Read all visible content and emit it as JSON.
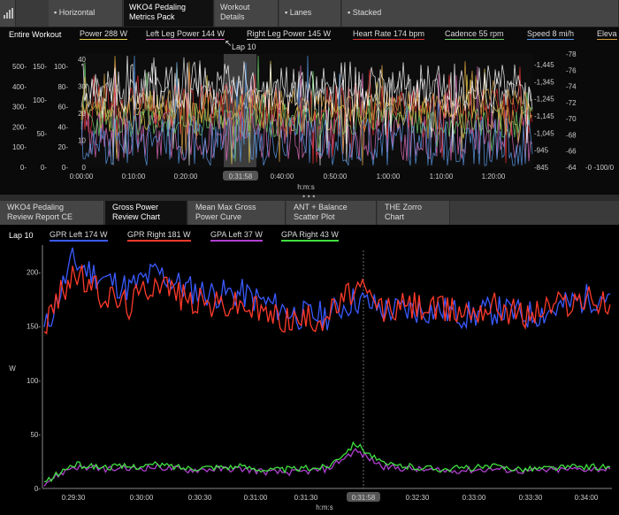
{
  "top_tabs": [
    {
      "label": "▪ Horizontal"
    },
    {
      "label": "WKO4 Pedaling\nMetrics Pack"
    },
    {
      "label": "Workout\nDetails"
    },
    {
      "label": "▪ Lanes"
    },
    {
      "label": "▪ Stacked"
    }
  ],
  "top_chart": {
    "range_label": "Entire Workout",
    "legend": [
      {
        "label": "Power  288 W",
        "color": "#e8d44d"
      },
      {
        "label": "Left Leg Power  144 W",
        "color": "#e070c0"
      },
      {
        "label": "Right Leg Power  145 W",
        "color": "#d8d8d8"
      },
      {
        "label": "Heart Rate  174 bpm",
        "color": "#e03030"
      },
      {
        "label": "Cadence  55 rpm",
        "color": "#70d070"
      },
      {
        "label": "Speed  8 mi/h",
        "color": "#5a9ae8"
      },
      {
        "label": "Eleva",
        "color": "#d4a040"
      }
    ],
    "lap_label": "Lap 10",
    "axis_power": [
      "500-",
      "400-",
      "300-",
      "200-",
      "100-",
      "0-"
    ],
    "axis_hr": [
      "150-",
      "100-",
      "50-",
      "0-"
    ],
    "axis_cad": [
      "100-",
      "80-",
      "60-",
      "40-",
      "20-",
      "0-"
    ],
    "axis_speed": [
      "40",
      "30",
      "20",
      "10",
      "0"
    ],
    "axis_elev": [
      "-1,445",
      "-1,345",
      "-1,245",
      "-1,145",
      "-1,045",
      "-945",
      "-845"
    ],
    "axis_right2": [
      "-78",
      "-76",
      "-74",
      "-72",
      "-70",
      "-68",
      "-66",
      "-64"
    ],
    "axis_right3": "-0  -100/0",
    "x_ticks": [
      "0:00:00",
      "0:10:00",
      "0:20:00",
      "0:31:58",
      "0:40:00",
      "0:50:00",
      "1:00:00",
      "1:10:00",
      "1:20:00"
    ],
    "x_label": "h:m:s"
  },
  "bottom_tabs": [
    {
      "label": "WKO4 Pedaling\nReview Report CE"
    },
    {
      "label": "Gross Power\nReview Chart"
    },
    {
      "label": "Mean Max Gross\nPower Curve"
    },
    {
      "label": "ANT + Balance\nScatter Plot"
    },
    {
      "label": "THE Zorro\nChart"
    }
  ],
  "bottom_chart": {
    "range_label": "Lap 10",
    "legend": [
      {
        "label": "GPR Left  174 W",
        "color": "#3a5aff"
      },
      {
        "label": "GPR Right  181 W",
        "color": "#ff3a2a"
      },
      {
        "label": "GPA Left  37 W",
        "color": "#b040d0"
      },
      {
        "label": "GPA Right  43 W",
        "color": "#40e040"
      }
    ],
    "y_ticks": [
      "200-",
      "150-",
      "100-",
      "50-",
      "0-"
    ],
    "y_label": "W",
    "x_ticks": [
      "0:29:30",
      "0:30:00",
      "0:30:30",
      "0:31:00",
      "0:31:30",
      "0:31:58",
      "0:32:30",
      "0:33:00",
      "0:33:30",
      "0:34:00"
    ],
    "x_label": "h:m:s"
  },
  "chart_data": {
    "type": "line",
    "title": "",
    "xlabel": "h:m:s",
    "ylabel": "W",
    "ylim": [
      0,
      225
    ],
    "x": [
      "0:29:15",
      "0:29:30",
      "0:29:45",
      "0:30:00",
      "0:30:15",
      "0:30:30",
      "0:30:45",
      "0:31:00",
      "0:31:15",
      "0:31:30",
      "0:31:45",
      "0:32:00",
      "0:32:15",
      "0:32:30",
      "0:32:45",
      "0:33:00",
      "0:33:15",
      "0:33:30",
      "0:33:45",
      "0:34:00",
      "0:34:10"
    ],
    "series": [
      {
        "name": "GPR Left",
        "color": "#3a5aff",
        "values": [
          145,
          210,
          195,
          185,
          200,
          185,
          180,
          180,
          170,
          160,
          160,
          175,
          165,
          165,
          165,
          160,
          165,
          160,
          165,
          175,
          180
        ]
      },
      {
        "name": "GPR Right",
        "color": "#ff3a2a",
        "values": [
          150,
          200,
          180,
          170,
          195,
          175,
          170,
          170,
          160,
          155,
          160,
          185,
          165,
          170,
          165,
          165,
          170,
          160,
          170,
          175,
          170
        ]
      },
      {
        "name": "GPA Left",
        "color": "#b040d0",
        "values": [
          5,
          20,
          18,
          18,
          20,
          17,
          18,
          18,
          15,
          15,
          18,
          35,
          20,
          18,
          16,
          17,
          18,
          16,
          17,
          18,
          18
        ]
      },
      {
        "name": "GPA Right",
        "color": "#40e040",
        "values": [
          5,
          22,
          20,
          20,
          22,
          19,
          20,
          20,
          17,
          18,
          20,
          42,
          22,
          20,
          18,
          19,
          20,
          18,
          19,
          20,
          20
        ]
      }
    ]
  }
}
